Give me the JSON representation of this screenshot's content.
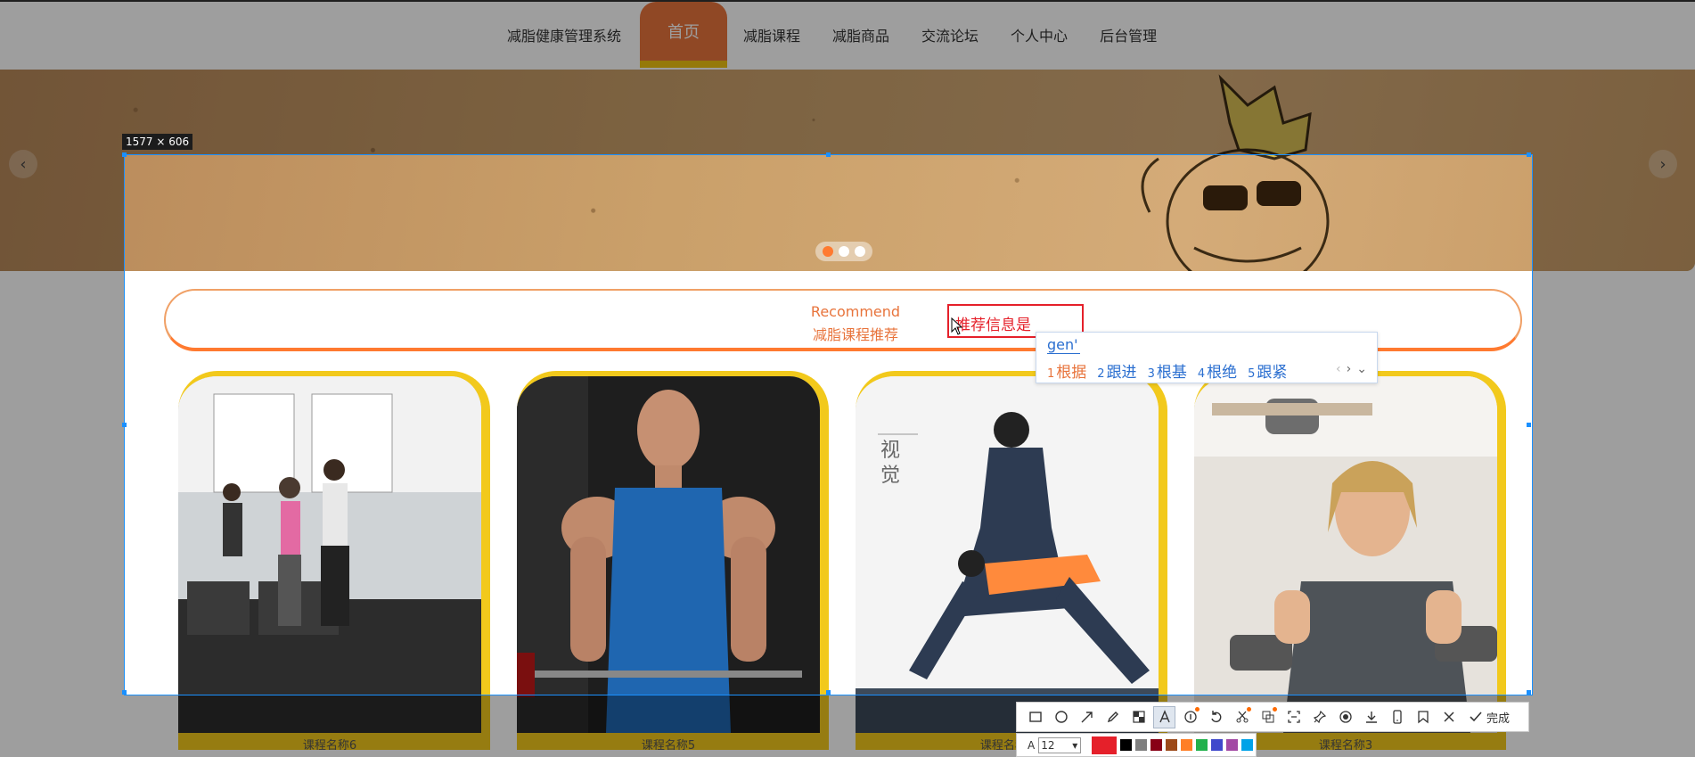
{
  "nav": {
    "site_title": "减脂健康管理系统",
    "items": [
      {
        "label": "首页",
        "active": true
      },
      {
        "label": "减脂课程"
      },
      {
        "label": "减脂商品"
      },
      {
        "label": "交流论坛"
      },
      {
        "label": "个人中心"
      },
      {
        "label": "后台管理"
      }
    ]
  },
  "banner": {
    "prev_icon": "chevron-left-icon",
    "next_icon": "chevron-right-icon",
    "dots": 3,
    "active_dot": 0
  },
  "recommend": {
    "title_en": "Recommend",
    "title_cn": "减脂课程推荐"
  },
  "cards": [
    {
      "caption": "课程名称6"
    },
    {
      "caption": "课程名称5"
    },
    {
      "caption": "课程名称4"
    },
    {
      "caption": "课程名称3"
    }
  ],
  "screenshot_tool": {
    "size_label": "1577 × 606",
    "text_annotation": "推荐信息是",
    "text_color": "#e5202a",
    "ime": {
      "input": "gen'",
      "candidates": [
        {
          "num": "1",
          "text": "根据"
        },
        {
          "num": "2",
          "text": "跟进"
        },
        {
          "num": "3",
          "text": "根基"
        },
        {
          "num": "4",
          "text": "根绝"
        },
        {
          "num": "5",
          "text": "跟紧"
        }
      ]
    },
    "done_label": "完成",
    "font_size_label": "A",
    "font_size": "12",
    "swatches": [
      "#000000",
      "#7f7f7f",
      "#880015",
      "#9c4a1a",
      "#ff7f27",
      "#22b14c",
      "#3f48cc",
      "#a349a4",
      "#00a2e8"
    ]
  }
}
